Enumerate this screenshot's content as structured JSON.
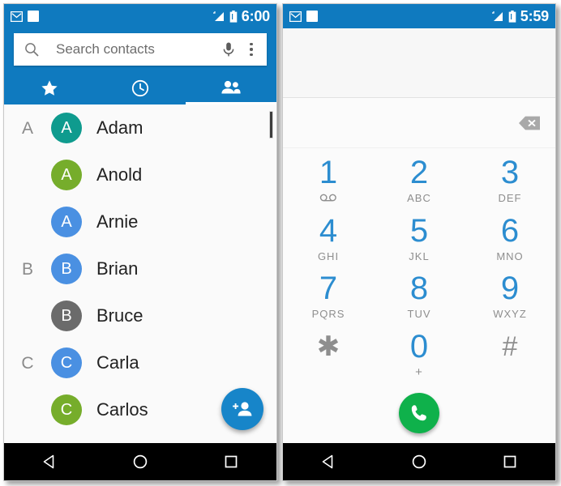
{
  "contacts_phone": {
    "status_bar": {
      "time": "6:00",
      "icons_left": [
        "gmail-icon",
        "white-square-icon"
      ],
      "icons_right": [
        "signal-icon",
        "battery-icon"
      ]
    },
    "search": {
      "placeholder": "Search contacts",
      "value": "",
      "icon": "search-icon",
      "mic_icon": "microphone-icon",
      "overflow_icon": "overflow-menu-icon"
    },
    "tabs": [
      {
        "name": "favorites",
        "icon": "star-icon",
        "active": false
      },
      {
        "name": "recents",
        "icon": "clock-icon",
        "active": false
      },
      {
        "name": "contacts",
        "icon": "people-icon",
        "active": true
      }
    ],
    "list": [
      {
        "section": "A",
        "name": "Adam",
        "initial": "A",
        "color": "#0f9b8e"
      },
      {
        "section": "",
        "name": "Anold",
        "initial": "A",
        "color": "#76ad2b"
      },
      {
        "section": "",
        "name": "Arnie",
        "initial": "A",
        "color": "#4a90e2"
      },
      {
        "section": "B",
        "name": "Brian",
        "initial": "B",
        "color": "#4a90e2"
      },
      {
        "section": "",
        "name": "Bruce",
        "initial": "B",
        "color": "#6b6b6b"
      },
      {
        "section": "C",
        "name": "Carla",
        "initial": "C",
        "color": "#4a90e2"
      },
      {
        "section": "",
        "name": "Carlos",
        "initial": "C",
        "color": "#76ad2b"
      }
    ],
    "fab": {
      "icon": "add-person-icon",
      "color": "#1785c9"
    },
    "nav": [
      {
        "name": "back",
        "icon": "back-triangle-icon"
      },
      {
        "name": "home",
        "icon": "home-circle-icon"
      },
      {
        "name": "recents",
        "icon": "recents-square-icon"
      }
    ]
  },
  "dialer_phone": {
    "status_bar": {
      "time": "5:59",
      "icons_left": [
        "gmail-icon",
        "white-square-icon"
      ],
      "icons_right": [
        "signal-icon",
        "battery-icon"
      ]
    },
    "number_input": {
      "value": "",
      "backspace_icon": "backspace-icon"
    },
    "keys": [
      [
        {
          "main": "1",
          "sub": "",
          "sub_icon": "voicemail-icon",
          "symbol": false
        },
        {
          "main": "2",
          "sub": "ABC",
          "symbol": false
        },
        {
          "main": "3",
          "sub": "DEF",
          "symbol": false
        }
      ],
      [
        {
          "main": "4",
          "sub": "GHI",
          "symbol": false
        },
        {
          "main": "5",
          "sub": "JKL",
          "symbol": false
        },
        {
          "main": "6",
          "sub": "MNO",
          "symbol": false
        }
      ],
      [
        {
          "main": "7",
          "sub": "PQRS",
          "symbol": false
        },
        {
          "main": "8",
          "sub": "TUV",
          "symbol": false
        },
        {
          "main": "9",
          "sub": "WXYZ",
          "symbol": false
        }
      ],
      [
        {
          "main": "✱",
          "sub": "",
          "symbol": true
        },
        {
          "main": "0",
          "sub": "+",
          "symbol": false
        },
        {
          "main": "#",
          "sub": "",
          "symbol": true
        }
      ]
    ],
    "call_button": {
      "icon": "phone-handset-icon",
      "color": "#0fb14b"
    },
    "nav": [
      {
        "name": "back",
        "icon": "back-triangle-icon"
      },
      {
        "name": "home",
        "icon": "home-circle-icon"
      },
      {
        "name": "recents",
        "icon": "recents-square-icon"
      }
    ]
  },
  "theme": {
    "primary": "#0f7abf",
    "key_blue": "#2c8dd0",
    "call_green": "#0fb14b",
    "nav_black": "#000000"
  }
}
